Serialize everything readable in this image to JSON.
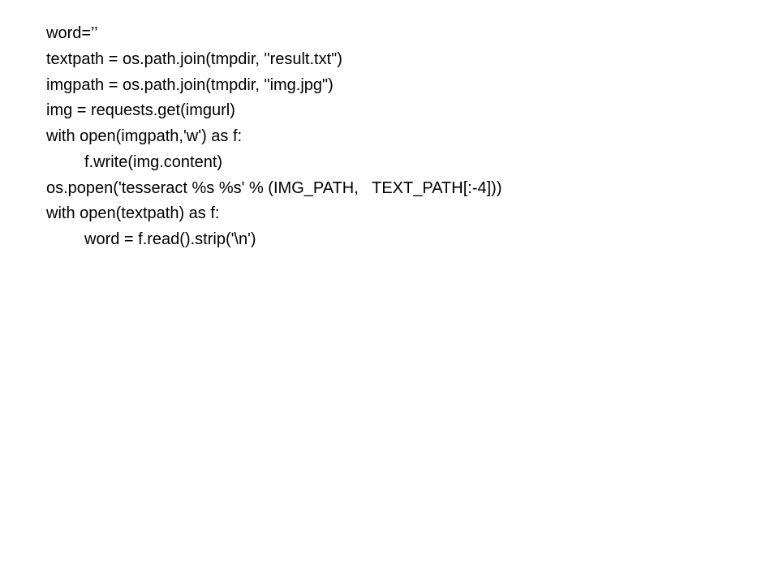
{
  "code": {
    "lines": [
      {
        "text": "word=’’",
        "indent": 0
      },
      {
        "text": "textpath = os.path.join(tmpdir, \"result.txt\")",
        "indent": 0
      },
      {
        "text": "imgpath = os.path.join(tmpdir, \"img.jpg\")",
        "indent": 0
      },
      {
        "text": "img = requests.get(imgurl)",
        "indent": 0
      },
      {
        "text": "with open(imgpath,'w') as f:",
        "indent": 0
      },
      {
        "text": "f.write(img.content)",
        "indent": 1
      },
      {
        "text": "os.popen('tesseract %s %s' % (IMG_PATH,   TEXT_PATH[:-4]))",
        "indent": 0
      },
      {
        "text": "with open(textpath) as f:",
        "indent": 0
      },
      {
        "text": "word = f.read().strip('\\n')",
        "indent": 1
      }
    ]
  }
}
